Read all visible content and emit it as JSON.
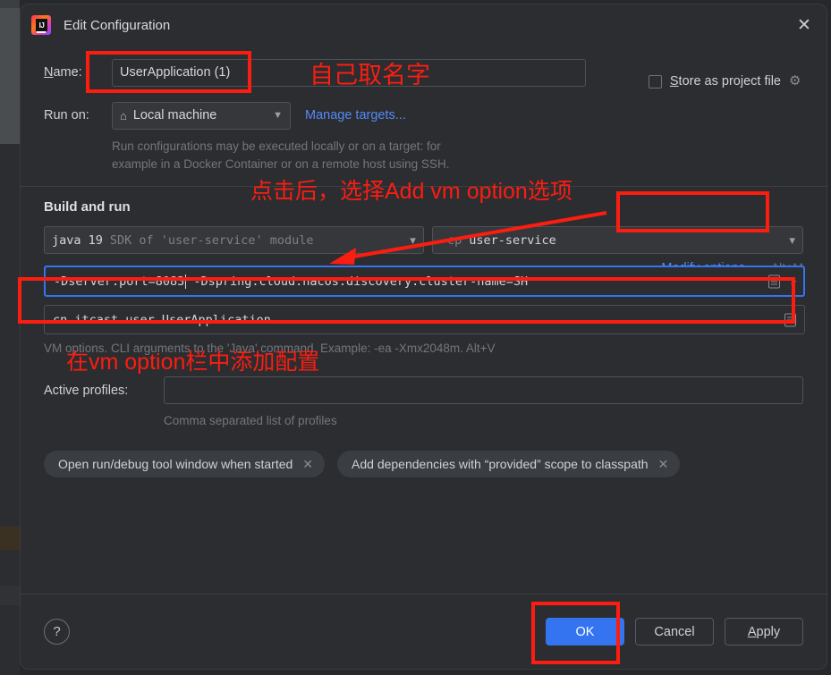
{
  "window": {
    "title": "Edit Configuration",
    "app_icon": "intellij-idea-icon",
    "close_icon": "close-icon"
  },
  "form": {
    "name_label": "Name:",
    "name_value": "UserApplication (1)",
    "store_as_project_file_label": "Store as project file",
    "store_as_project_file_checked": false,
    "gear_icon": "gear-icon",
    "run_on_label": "Run on:",
    "run_on_value": "Local machine",
    "run_on_icon": "home-icon",
    "manage_targets_link": "Manage targets...",
    "run_on_hint_line1": "Run configurations may be executed locally or on a target: for",
    "run_on_hint_line2": "example in a Docker Container or on a remote host using SSH."
  },
  "build_and_run": {
    "section_title": "Build and run",
    "modify_options_label": "Modify options",
    "modify_options_shortcut": "Alt+M",
    "sdk_value_strong": "java 19",
    "sdk_value_dim": "SDK of 'user-service' module",
    "cp_value_dim": "-cp",
    "cp_value_strong": "user-service",
    "vm_options_value_part1": "-Dserver.port=8083",
    "vm_options_value_part2": "-Dspring.cloud.nacos.discovery.cluster-name=SH",
    "main_class_value": "cn.itcast.user.UserApplication",
    "vm_options_hint": "VM options. CLI arguments to the 'Java' command. Example: -ea -Xmx2048m. Alt+V",
    "active_profiles_label": "Active profiles:",
    "active_profiles_value": "",
    "active_profiles_hint": "Comma separated list of profiles",
    "chips": [
      {
        "label": "Open run/debug tool window when started",
        "close_icon": "chip-close-icon"
      },
      {
        "label": "Add dependencies with “provided” scope to classpath",
        "close_icon": "chip-close-icon"
      }
    ]
  },
  "footer": {
    "help_label": "?",
    "ok_label": "OK",
    "cancel_label": "Cancel",
    "apply_label": "Apply"
  },
  "annotations": {
    "color": "#fc1d11",
    "name_note": "自己取名字",
    "modify_note": "点击后，选择Add vm option选项",
    "vm_note": "在vm option栏中添加配置"
  }
}
